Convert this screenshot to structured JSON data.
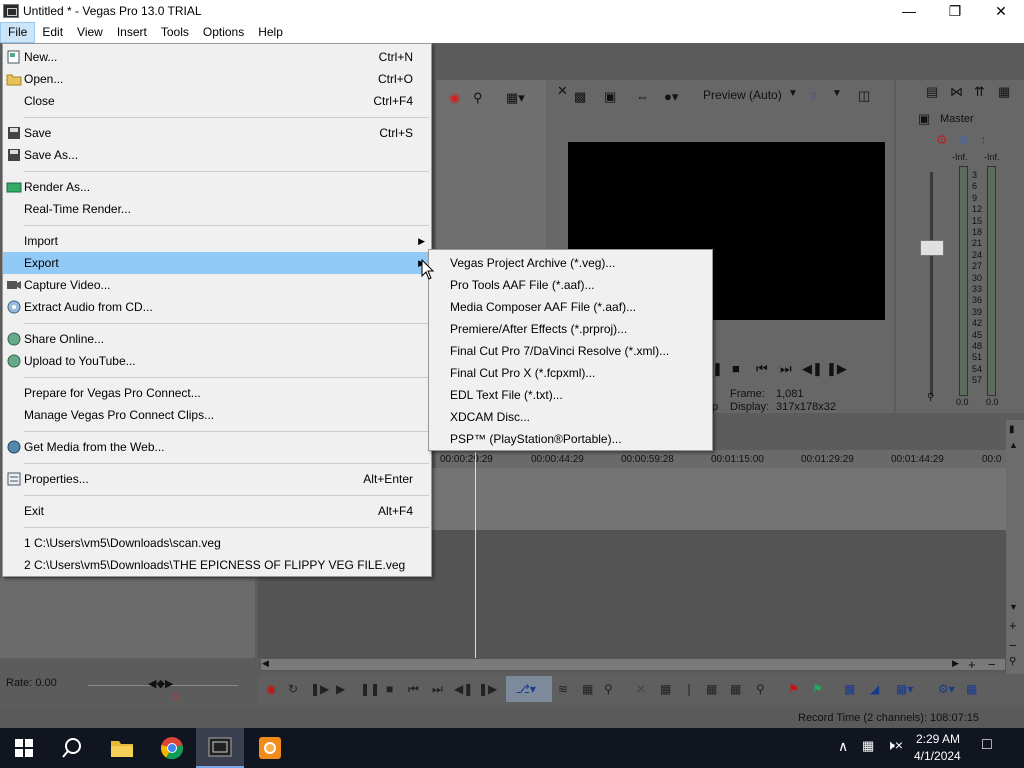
{
  "window": {
    "title": "Untitled * - Vegas Pro 13.0 TRIAL"
  },
  "menubar": [
    "File",
    "Edit",
    "View",
    "Insert",
    "Tools",
    "Options",
    "Help"
  ],
  "file_menu": {
    "items": [
      {
        "label": "New...",
        "shortcut": "Ctrl+N"
      },
      {
        "label": "Open...",
        "shortcut": "Ctrl+O"
      },
      {
        "label": "Close",
        "shortcut": "Ctrl+F4"
      },
      {
        "label": "Save",
        "shortcut": "Ctrl+S"
      },
      {
        "label": "Save As...",
        "shortcut": ""
      },
      {
        "label": "Render As...",
        "shortcut": ""
      },
      {
        "label": "Real-Time Render...",
        "shortcut": ""
      },
      {
        "label": "Import",
        "shortcut": ""
      },
      {
        "label": "Export",
        "shortcut": ""
      },
      {
        "label": "Capture Video...",
        "shortcut": ""
      },
      {
        "label": "Extract Audio from CD...",
        "shortcut": ""
      },
      {
        "label": "Share Online...",
        "shortcut": ""
      },
      {
        "label": "Upload to YouTube...",
        "shortcut": ""
      },
      {
        "label": "Prepare for Vegas Pro Connect...",
        "shortcut": ""
      },
      {
        "label": "Manage Vegas Pro Connect Clips...",
        "shortcut": ""
      },
      {
        "label": "Get Media from the Web...",
        "shortcut": ""
      },
      {
        "label": "Properties...",
        "shortcut": "Alt+Enter"
      },
      {
        "label": "Exit",
        "shortcut": "Alt+F4"
      },
      {
        "label": "1 C:\\Users\\vm5\\Downloads\\scan.veg",
        "shortcut": ""
      },
      {
        "label": "2 C:\\Users\\vm5\\Downloads\\THE EPICNESS OF FLIPPY VEG FILE.veg",
        "shortcut": ""
      }
    ]
  },
  "export_submenu": [
    "Vegas Project Archive (*.veg)...",
    "Pro Tools AAF File (*.aaf)...",
    "Media Composer AAF File (*.aaf)...",
    "Premiere/After Effects (*.prproj)...",
    "Final Cut Pro 7/DaVinci Resolve (*.xml)...",
    "Final Cut Pro X (*.fcpxml)...",
    "EDL Text File (*.txt)...",
    "XDCAM Disc...",
    "PSP™ (PlayStation®Portable)..."
  ],
  "preview": {
    "mode": "Preview (Auto)",
    "frame_label": "Frame:",
    "frame_value": "1,081",
    "display_label": "Display:",
    "display_value": "317x178x32"
  },
  "mixer": {
    "title": "Master",
    "left_inf": "-Inf.",
    "right_inf": "-Inf.",
    "scale": [
      "3",
      "6",
      "9",
      "12",
      "15",
      "18",
      "21",
      "24",
      "27",
      "30",
      "33",
      "36",
      "39",
      "42",
      "45",
      "48",
      "51",
      "54",
      "57"
    ],
    "left_value": "0.0",
    "right_value": "0.0"
  },
  "timeline": {
    "ruler_labels": [
      "00:00:29:29",
      "00:00:44:29",
      "00:00:59:28",
      "00:01:15:00",
      "00:01:29:29",
      "00:01:44:29",
      "00:0"
    ]
  },
  "rate": "Rate: 0.00",
  "status": "Record Time (2 channels): 108:07:15",
  "taskbar": {
    "time": "2:29 AM",
    "date": "4/1/2024"
  }
}
